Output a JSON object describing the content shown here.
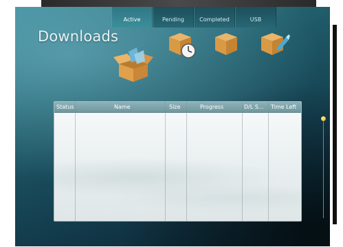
{
  "page": {
    "title": "Downloads"
  },
  "tabs": [
    {
      "label": "Active",
      "selected": true,
      "icon": "open-box-icon"
    },
    {
      "label": "Pending",
      "selected": false,
      "icon": "box-clock-icon"
    },
    {
      "label": "Completed",
      "selected": false,
      "icon": "closed-box-icon"
    },
    {
      "label": "USB",
      "selected": false,
      "icon": "box-usb-icon"
    }
  ],
  "table": {
    "columns": [
      "Status",
      "Name",
      "Size",
      "Progress",
      "D/L S...",
      "Time Left"
    ],
    "rows": []
  },
  "colors": {
    "accent": "#3c8e9b",
    "header": "#7fa6ad",
    "scroll_thumb": "#e3c33a"
  }
}
